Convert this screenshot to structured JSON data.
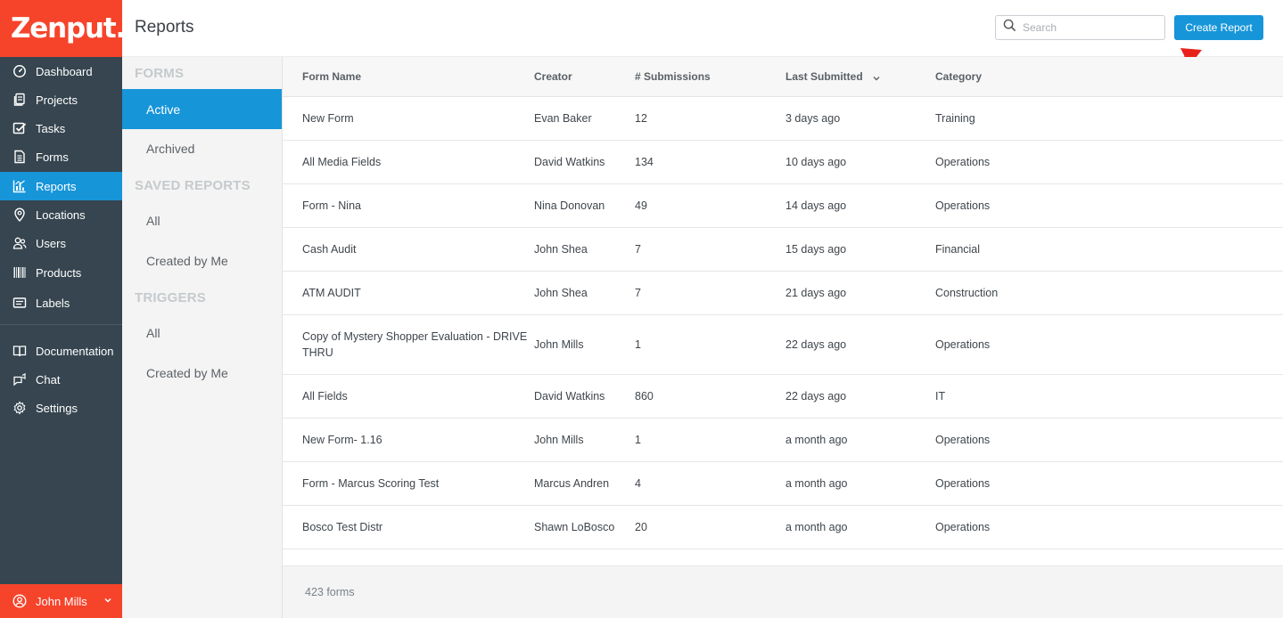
{
  "app": {
    "logo_text": "Zenput."
  },
  "nav": {
    "items": [
      {
        "label": "Dashboard",
        "icon": "dashboard-icon"
      },
      {
        "label": "Projects",
        "icon": "projects-icon"
      },
      {
        "label": "Tasks",
        "icon": "tasks-icon"
      },
      {
        "label": "Forms",
        "icon": "forms-icon"
      },
      {
        "label": "Reports",
        "icon": "reports-icon",
        "active": true
      },
      {
        "label": "Locations",
        "icon": "location-pin-icon"
      },
      {
        "label": "Users",
        "icon": "users-icon"
      },
      {
        "label": "Products",
        "icon": "barcode-icon"
      },
      {
        "label": "Labels",
        "icon": "labels-icon"
      },
      {
        "label": "Documentation",
        "icon": "book-icon"
      },
      {
        "label": "Chat",
        "icon": "chat-icon"
      },
      {
        "label": "Settings",
        "icon": "gear-icon"
      }
    ],
    "user": {
      "name": "John Mills",
      "icon": "user-circle-icon"
    }
  },
  "header": {
    "title": "Reports",
    "search_placeholder": "Search",
    "create_label": "Create Report"
  },
  "subnav": {
    "forms_heading": "FORMS",
    "forms_active": "Active",
    "forms_archived": "Archived",
    "saved_heading": "SAVED REPORTS",
    "saved_all": "All",
    "saved_mine": "Created by Me",
    "triggers_heading": "TRIGGERS",
    "triggers_all": "All",
    "triggers_mine": "Created by Me"
  },
  "table": {
    "headers": {
      "name": "Form Name",
      "creator": "Creator",
      "submissions": "# Submissions",
      "last": "Last Submitted",
      "category": "Category"
    },
    "rows": [
      {
        "name": "New Form",
        "creator": "Evan Baker",
        "submissions": "12",
        "last": "3 days ago",
        "category": "Training"
      },
      {
        "name": "All Media Fields",
        "creator": "David Watkins",
        "submissions": "134",
        "last": "10 days ago",
        "category": "Operations"
      },
      {
        "name": "Form - Nina",
        "creator": "Nina Donovan",
        "submissions": "49",
        "last": "14 days ago",
        "category": "Operations"
      },
      {
        "name": "Cash Audit",
        "creator": "John Shea",
        "submissions": "7",
        "last": "15 days ago",
        "category": "Financial"
      },
      {
        "name": "ATM AUDIT",
        "creator": "John Shea",
        "submissions": "7",
        "last": "21 days ago",
        "category": "Construction"
      },
      {
        "name": "Copy of Mystery Shopper Evaluation - DRIVE THRU",
        "creator": "John Mills",
        "submissions": "1",
        "last": "22 days ago",
        "category": "Operations"
      },
      {
        "name": "All Fields",
        "creator": "David Watkins",
        "submissions": "860",
        "last": "22 days ago",
        "category": "IT"
      },
      {
        "name": "New Form- 1.16",
        "creator": "John Mills",
        "submissions": "1",
        "last": "a month ago",
        "category": "Operations"
      },
      {
        "name": "Form - Marcus Scoring Test",
        "creator": "Marcus Andren",
        "submissions": "4",
        "last": "a month ago",
        "category": "Operations"
      },
      {
        "name": "Bosco Test Distr",
        "creator": "Shawn LoBosco",
        "submissions": "20",
        "last": "a month ago",
        "category": "Operations"
      }
    ],
    "footer_count": "423 forms"
  },
  "colors": {
    "brand_red": "#f6442b",
    "accent_blue": "#1795d9",
    "sidebar_dark": "#36454f",
    "annotation_arrow": "#e8221b"
  }
}
